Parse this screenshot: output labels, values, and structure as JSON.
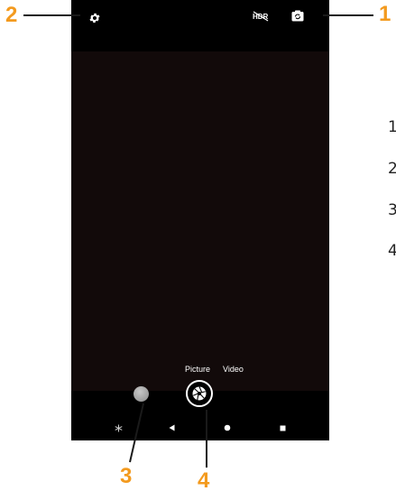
{
  "camera": {
    "modes": {
      "picture_label": "Picture",
      "video_label": "Video"
    },
    "icons": {
      "settings": "gear-icon",
      "hdr": "hdr-off-icon",
      "switch_camera": "switch-camera-icon",
      "shutter": "aperture-icon",
      "gallery_thumbnail": "gallery-thumbnail",
      "nav_extra": "asterisk-icon",
      "nav_back": "back-triangle-icon",
      "nav_home": "home-circle-icon",
      "nav_recents": "recents-square-icon"
    }
  },
  "callouts": {
    "c1": "1",
    "c2": "2",
    "c3": "3",
    "c4": "4"
  },
  "legend": [
    "1",
    "2",
    "3",
    "4"
  ],
  "colors": {
    "callout_accent": "#f39a1e",
    "viewfinder": "#120a0a",
    "bars": "#000000"
  }
}
